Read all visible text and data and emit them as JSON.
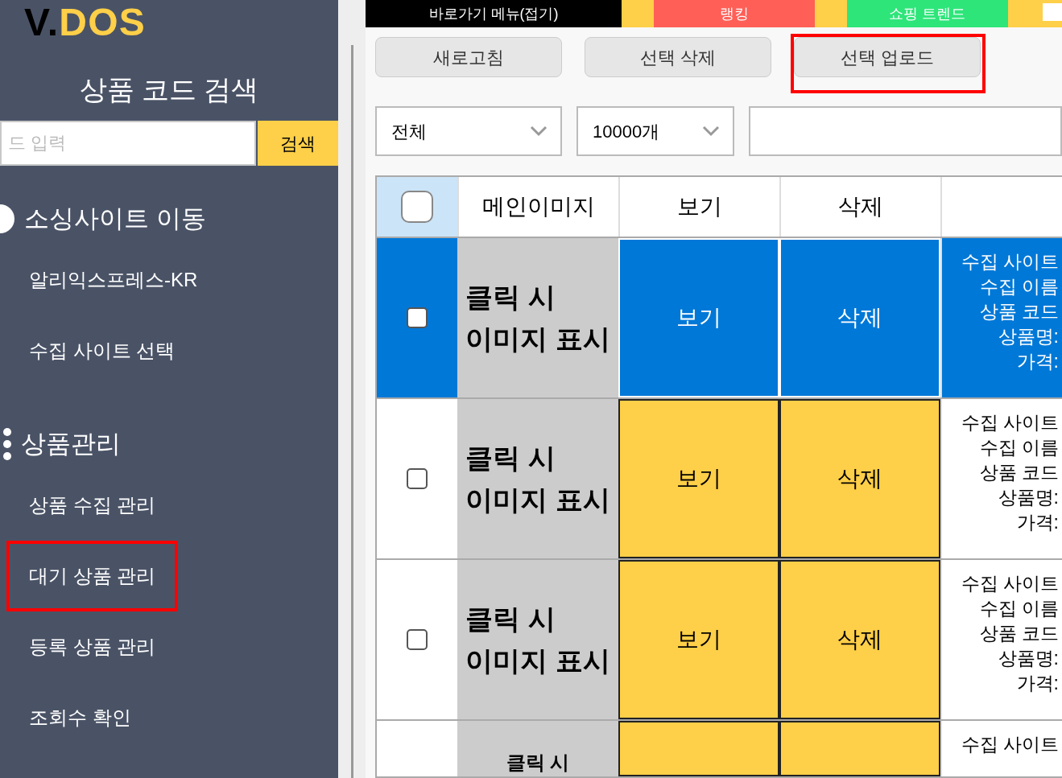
{
  "sidebar": {
    "logo": {
      "first": "V.",
      "second": "DOS"
    },
    "search_title": "상품 코드 검색",
    "search": {
      "placeholder": "드 입력",
      "button": "검색"
    },
    "sections": [
      {
        "kind": "circle",
        "title": "소싱사이트 이동",
        "items": [
          {
            "label": "알리익스프레스-KR",
            "highlighted": false
          },
          {
            "label": "수집 사이트 선택",
            "highlighted": false
          }
        ]
      },
      {
        "kind": "dots",
        "title": "상품관리",
        "items": [
          {
            "label": "상품 수집 관리",
            "highlighted": false
          },
          {
            "label": "대기 상품 관리",
            "highlighted": true
          },
          {
            "label": "등록 상품 관리",
            "highlighted": false
          },
          {
            "label": "조회수 확인",
            "highlighted": false
          }
        ]
      }
    ]
  },
  "top_menu": [
    {
      "label": "바로가기 메뉴(접기)",
      "color": "#000000"
    },
    {
      "label": "랭킹",
      "color": "#ff5f57"
    },
    {
      "label": "쇼핑 트렌드",
      "color": "#2ee57a"
    }
  ],
  "toolbar": [
    {
      "label": "새로고침",
      "highlighted": false
    },
    {
      "label": "선택 삭제",
      "highlighted": false
    },
    {
      "label": "선택 업로드",
      "highlighted": true
    }
  ],
  "filters": [
    {
      "value": "전체"
    },
    {
      "value": "10000개"
    }
  ],
  "table": {
    "columns": [
      "메인이미지",
      "보기",
      "삭제"
    ],
    "header_checked": false,
    "rows": [
      {
        "selected": true,
        "checked": false,
        "image": "클릭 시\n이미지 표시",
        "view": "보기",
        "delete": "삭제",
        "info": [
          "수집 사이트",
          "수집 이름",
          "상품 코드",
          "상품명:",
          "가격:"
        ]
      },
      {
        "selected": false,
        "checked": false,
        "image": "클릭 시\n이미지 표시",
        "view": "보기",
        "delete": "삭제",
        "info": [
          "수집 사이트",
          "수집 이름",
          "상품 코드",
          "상품명:",
          "가격:"
        ]
      },
      {
        "selected": false,
        "checked": false,
        "image": "클릭 시\n이미지 표시",
        "view": "보기",
        "delete": "삭제",
        "info": [
          "수집 사이트",
          "수집 이름",
          "상품 코드",
          "상품명:",
          "가격:"
        ]
      },
      {
        "selected": false,
        "image": "클릭 시",
        "info": [
          "수집 사이트"
        ]
      }
    ]
  }
}
